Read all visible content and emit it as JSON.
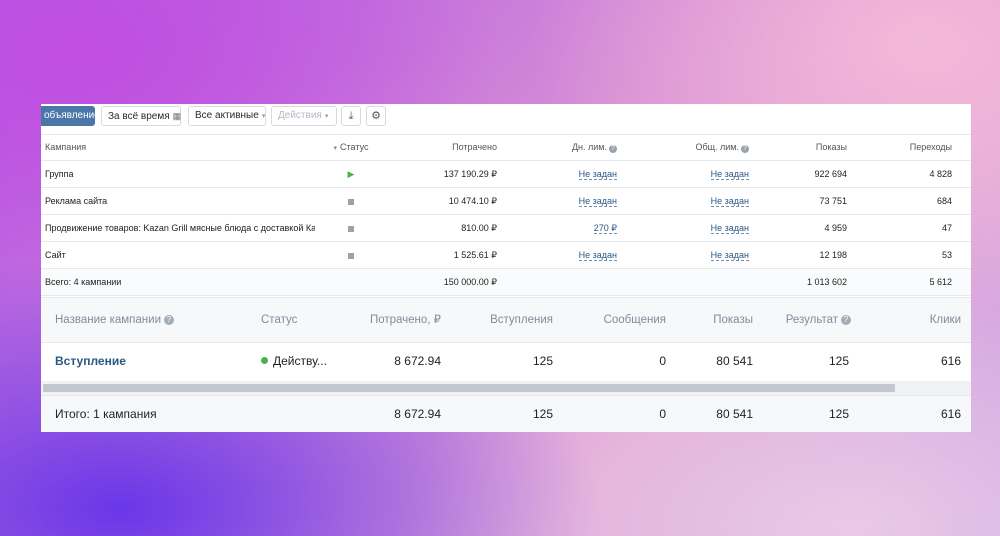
{
  "toolbar": {
    "primary_label": "объявление",
    "period_label": "За всё время",
    "filter_label": "Все активные",
    "actions_label": "Действия",
    "download_icon": "download-icon",
    "settings_icon": "gear-icon"
  },
  "old_table": {
    "headers": {
      "name": "Кампания",
      "status": "Статус",
      "spent": "Потрачено",
      "day_limit": "Дн. лим.",
      "total_limit": "Общ. лим.",
      "views": "Показы",
      "clicks": "Переходы"
    },
    "rows": [
      {
        "name": "Группа",
        "status": "active",
        "spent": "137 190.29 ₽",
        "day_limit": "Не задан",
        "total_limit": "Не задан",
        "views": "922 694",
        "clicks": "4 828"
      },
      {
        "name": "Реклама сайта",
        "status": "stopped",
        "spent": "10 474.10 ₽",
        "day_limit": "Не задан",
        "total_limit": "Не задан",
        "views": "73 751",
        "clicks": "684"
      },
      {
        "name": "Продвижение товаров: Kazan Grill мясные блюда с доставкой Ка",
        "status": "stopped",
        "spent": "810.00 ₽",
        "day_limit": "270 ₽",
        "total_limit": "Не задан",
        "views": "4 959",
        "clicks": "47"
      },
      {
        "name": "Сайт",
        "status": "stopped",
        "spent": "1 525.61 ₽",
        "day_limit": "Не задан",
        "total_limit": "Не задан",
        "views": "12 198",
        "clicks": "53"
      }
    ],
    "total": {
      "label": "Всего: 4 кампании",
      "spent": "150 000.00 ₽",
      "views": "1 013 602",
      "clicks": "5 612"
    }
  },
  "new_table": {
    "headers": {
      "name": "Название кампании",
      "status": "Статус",
      "spent": "Потрачено, ₽",
      "joins": "Вступления",
      "messages": "Сообщения",
      "views": "Показы",
      "result": "Результат",
      "clicks": "Клики"
    },
    "rows": [
      {
        "name": "Вступление",
        "status": "Действу...",
        "spent": "8 672.94",
        "joins": "125",
        "messages": "0",
        "views": "80 541",
        "result": "125",
        "clicks": "616"
      }
    ],
    "total": {
      "label": "Итого: 1 кампания",
      "spent": "8 672.94",
      "joins": "125",
      "messages": "0",
      "views": "80 541",
      "result": "125",
      "clicks": "616"
    }
  },
  "colors": {
    "accent": "#4a76a8",
    "link": "#2a5885",
    "active_status": "#4bb34b"
  }
}
